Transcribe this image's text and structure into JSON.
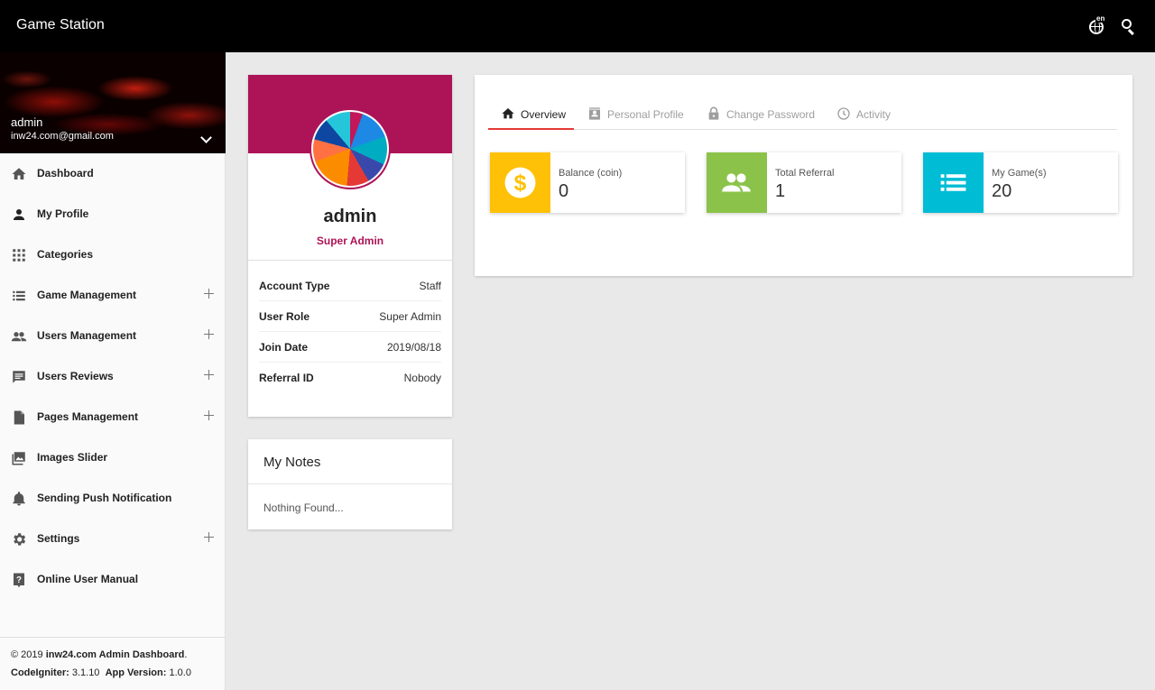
{
  "header": {
    "brand": "Game Station",
    "lang_code": "en"
  },
  "sidebar": {
    "user": {
      "name": "admin",
      "email": "inw24.com@gmail.com"
    },
    "items": [
      {
        "label": "Dashboard",
        "icon": "home-icon",
        "expandable": false
      },
      {
        "label": "My Profile",
        "icon": "person-icon",
        "expandable": false
      },
      {
        "label": "Categories",
        "icon": "grid-icon",
        "expandable": false
      },
      {
        "label": "Game Management",
        "icon": "list-icon",
        "expandable": true
      },
      {
        "label": "Users Management",
        "icon": "people-icon",
        "expandable": true
      },
      {
        "label": "Users Reviews",
        "icon": "chat-icon",
        "expandable": true
      },
      {
        "label": "Pages Management",
        "icon": "document-icon",
        "expandable": true
      },
      {
        "label": "Images Slider",
        "icon": "image-icon",
        "expandable": false
      },
      {
        "label": "Sending Push Notification",
        "icon": "bell-icon",
        "expandable": false
      },
      {
        "label": "Settings",
        "icon": "gear-icon",
        "expandable": true
      },
      {
        "label": "Online User Manual",
        "icon": "help-icon",
        "expandable": false
      }
    ],
    "footer": {
      "copyright_prefix": "© 2019 ",
      "site": "inw24.com Admin Dashboard",
      "copyright_suffix": ".",
      "framework_label": "CodeIgniter:",
      "framework_version": "3.1.10",
      "app_label": "App Version:",
      "app_version": "1.0.0"
    }
  },
  "profile": {
    "name": "admin",
    "role": "Super Admin",
    "details": [
      {
        "key": "Account Type",
        "value": "Staff"
      },
      {
        "key": "User Role",
        "value": "Super Admin"
      },
      {
        "key": "Join Date",
        "value": "2019/08/18"
      },
      {
        "key": "Referral ID",
        "value": "Nobody"
      }
    ]
  },
  "notes": {
    "title": "My Notes",
    "empty_text": "Nothing Found..."
  },
  "overview": {
    "tabs": [
      {
        "label": "Overview",
        "icon": "home-icon",
        "active": true
      },
      {
        "label": "Personal Profile",
        "icon": "contact-card-icon",
        "active": false
      },
      {
        "label": "Change Password",
        "icon": "lock-icon",
        "active": false
      },
      {
        "label": "Activity",
        "icon": "clock-icon",
        "active": false
      }
    ],
    "stats": [
      {
        "label": "Balance (coin)",
        "value": "0",
        "icon": "dollar-icon",
        "color": "#ffc107"
      },
      {
        "label": "Total Referral",
        "value": "1",
        "icon": "people-icon",
        "color": "#8bc34a"
      },
      {
        "label": "My Game(s)",
        "value": "20",
        "icon": "list-icon",
        "color": "#00bcd4"
      }
    ]
  },
  "colors": {
    "topbar": "#000000",
    "accent": "#ad1457",
    "active_tab": "#e53935",
    "background": "#e9e9e9"
  }
}
